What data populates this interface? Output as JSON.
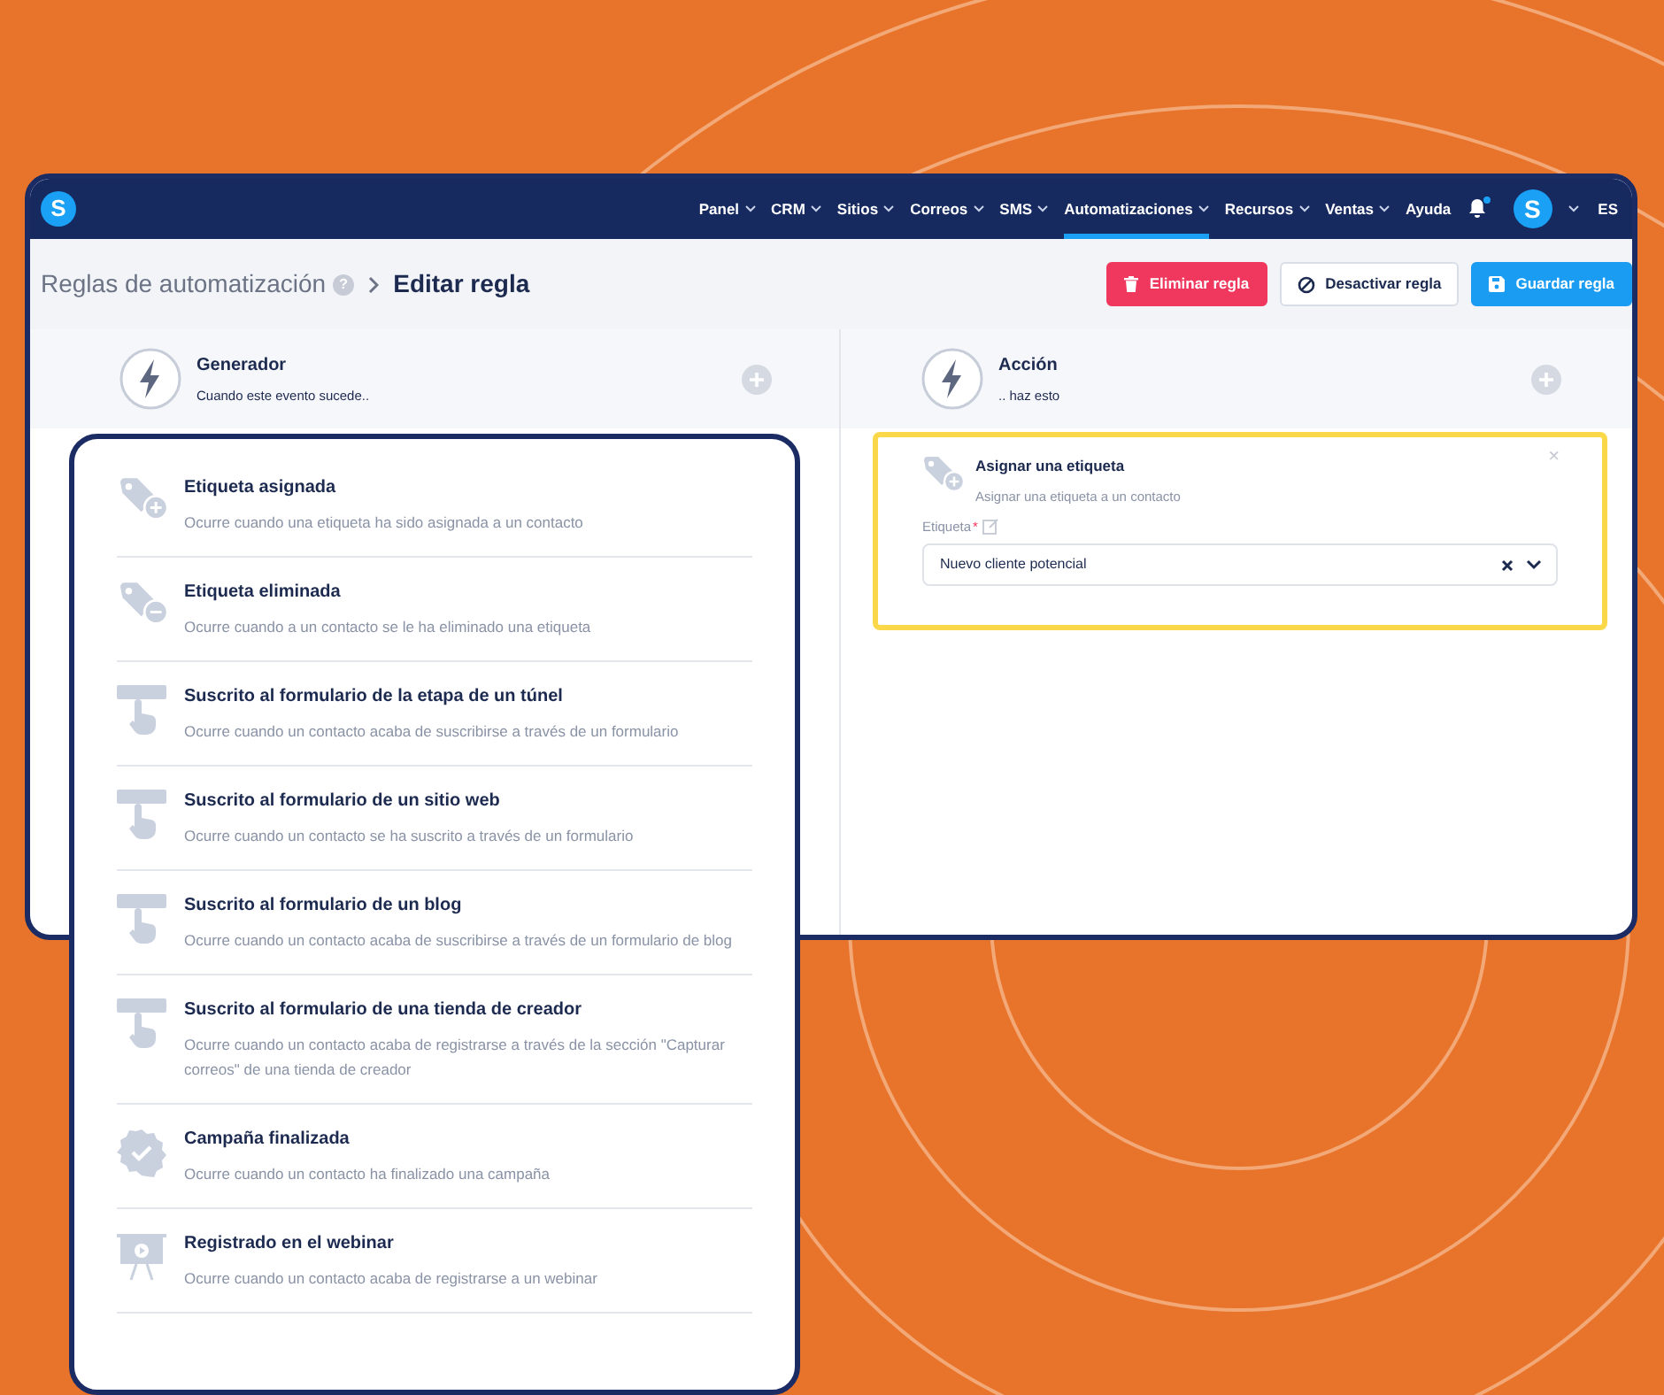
{
  "navbar": {
    "logo": "S",
    "items": [
      {
        "label": "Panel",
        "dropdown": true,
        "selected": false
      },
      {
        "label": "CRM",
        "dropdown": true,
        "selected": false
      },
      {
        "label": "Sitios",
        "dropdown": true,
        "selected": false
      },
      {
        "label": "Correos",
        "dropdown": true,
        "selected": false
      },
      {
        "label": "SMS",
        "dropdown": true,
        "selected": false
      },
      {
        "label": "Automatizaciones",
        "dropdown": true,
        "selected": true
      },
      {
        "label": "Recursos",
        "dropdown": true,
        "selected": false
      },
      {
        "label": "Ventas",
        "dropdown": true,
        "selected": false
      },
      {
        "label": "Ayuda",
        "dropdown": false,
        "selected": false
      }
    ],
    "notification_dot": true,
    "avatar": "S",
    "language": "ES"
  },
  "breadcrumb": {
    "parent": "Reglas de automatización",
    "help": "?",
    "current": "Editar regla"
  },
  "buttons": [
    {
      "kind": "delete",
      "label": "Eliminar regla"
    },
    {
      "kind": "deactivate",
      "label": "Desactivar regla"
    },
    {
      "kind": "save",
      "label": "Guardar regla"
    }
  ],
  "trigger_header": {
    "title": "Generador",
    "subtitle": "Cuando este evento sucede.."
  },
  "action_header": {
    "title": "Acción",
    "subtitle": ".. haz esto"
  },
  "action_card": {
    "title": "Asignar una etiqueta",
    "description": "Asignar una etiqueta a un contacto",
    "close": "×",
    "field_label": "Etiqueta",
    "required_mark": "*",
    "value": "Nuevo cliente potencial"
  },
  "triggers": [
    {
      "kind": "tag-add",
      "title": "Etiqueta asignada",
      "description": "Ocurre cuando una etiqueta ha sido asignada a un contacto"
    },
    {
      "kind": "tag-remove",
      "title": "Etiqueta eliminada",
      "description": "Ocurre cuando a un contacto se le ha eliminado una etiqueta"
    },
    {
      "kind": "form",
      "title": "Suscrito al formulario de la etapa de un túnel",
      "description": "Ocurre cuando un contacto acaba de suscribirse a través de un formulario"
    },
    {
      "kind": "form",
      "title": "Suscrito al formulario de un sitio web",
      "description": "Ocurre cuando un contacto se ha suscrito a través de un formulario"
    },
    {
      "kind": "form",
      "title": "Suscrito al formulario de un blog",
      "description": "Ocurre cuando un contacto acaba de suscribirse a través de un formulario de blog"
    },
    {
      "kind": "form",
      "title": "Suscrito al formulario de una tienda de creador",
      "description": "Ocurre cuando un contacto acaba de registrarse a través de la sección \"Capturar correos\" de una tienda de creador"
    },
    {
      "kind": "badge",
      "title": "Campaña finalizada",
      "description": "Ocurre cuando un contacto ha finalizado una campaña"
    },
    {
      "kind": "webinar",
      "title": "Registrado en el webinar",
      "description": "Ocurre cuando un contacto acaba de registrarse a un webinar"
    }
  ]
}
